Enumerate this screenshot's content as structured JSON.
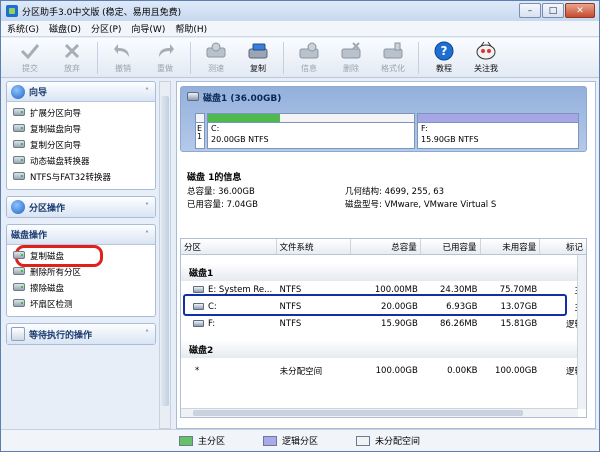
{
  "window": {
    "title": "分区助手3.0中文版 (稳定、易用且免费)"
  },
  "menu": [
    "系统(G)",
    "磁盘(D)",
    "分区(P)",
    "向导(W)",
    "帮助(H)"
  ],
  "toolbar": [
    {
      "label": "提交",
      "icon": "check-icon",
      "disabled": true
    },
    {
      "label": "放弃",
      "icon": "discard-icon",
      "disabled": true
    },
    {
      "label": "撤销",
      "icon": "undo-icon",
      "disabled": true
    },
    {
      "label": "重做",
      "icon": "redo-icon",
      "disabled": true
    },
    {
      "label": "测速",
      "icon": "speed-test-icon",
      "disabled": true
    },
    {
      "label": "复制",
      "icon": "copy-disk-icon",
      "disabled": false
    },
    {
      "label": "信息",
      "icon": "info-disk-icon",
      "disabled": true
    },
    {
      "label": "删除",
      "icon": "delete-disk-icon",
      "disabled": true
    },
    {
      "label": "格式化",
      "icon": "format-icon",
      "disabled": true
    },
    {
      "label": "教程",
      "icon": "help-icon",
      "disabled": false
    },
    {
      "label": "关注我",
      "icon": "follow-icon",
      "disabled": false
    }
  ],
  "sidebar": {
    "wizard": {
      "title": "向导",
      "items": [
        "扩展分区向导",
        "复制磁盘向导",
        "复制分区向导",
        "动态磁盘转换器",
        "NTFS与FAT32转换器"
      ]
    },
    "partition_ops": {
      "title": "分区操作"
    },
    "disk_ops": {
      "title": "磁盘操作",
      "items": [
        "复制磁盘",
        "删除所有分区",
        "擦除磁盘",
        "坏扇区检测"
      ]
    },
    "pending": {
      "title": "等待执行的操作"
    }
  },
  "disk_card": {
    "title": "磁盘1 (36.00GB)",
    "partitions": [
      {
        "letter": "E",
        "num": "1",
        "fill": 0.0,
        "color": "#4fb84f"
      },
      {
        "label": "C:",
        "size": "20.00GB NTFS",
        "fill": 0.35,
        "color": "#4fb84f"
      },
      {
        "label": "F:",
        "size": "15.90GB NTFS",
        "fill": 0.0,
        "color": "#a6a6e6"
      }
    ]
  },
  "info": {
    "title": "磁盘 1的信息",
    "total_label": "总容量: 36.00GB",
    "used_label": "已用容量: 7.04GB",
    "geometry_label": "几何结构: 4699, 255, 63",
    "model_label": "磁盘型号: VMware, VMware Virtual S"
  },
  "table": {
    "headers": [
      "分区",
      "文件系统",
      "总容量",
      "已用容量",
      "未用容量",
      "标记"
    ],
    "groups": [
      {
        "name": "磁盘1",
        "rows": [
          [
            "E:  System Re...",
            "NTFS",
            "100.00MB",
            "24.30MB",
            "75.70MB",
            "主"
          ],
          [
            "C:",
            "NTFS",
            "20.00GB",
            "6.93GB",
            "13.07GB",
            "主"
          ],
          [
            "F:",
            "NTFS",
            "15.90GB",
            "86.26MB",
            "15.81GB",
            "逻辑"
          ]
        ]
      },
      {
        "name": "磁盘2",
        "rows": [
          [
            "*",
            "未分配空间",
            "100.00GB",
            "0.00KB",
            "100.00GB",
            "逻辑"
          ]
        ]
      }
    ]
  },
  "legend": [
    {
      "label": "主分区",
      "color": "#67c267"
    },
    {
      "label": "逻辑分区",
      "color": "#a9a9ec"
    },
    {
      "label": "未分配空间",
      "color": "#f2f2f2"
    }
  ]
}
